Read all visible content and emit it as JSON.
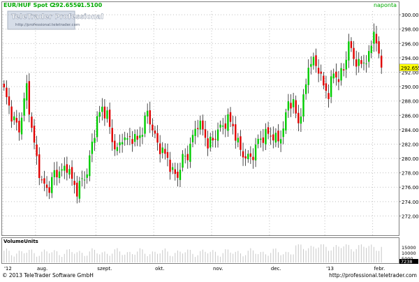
{
  "header": {
    "instrument_label": "EUR/HUF Spot C:",
    "last_price": "292.6550",
    "change": "-1.5100",
    "period_label": "naponta"
  },
  "logo": {
    "brand": "TeleTrader Professional",
    "url": "http://professional.teletrader.com"
  },
  "volume_panel": {
    "title": "VolumeUnits",
    "y_ticks": [
      "15000",
      "10000",
      "5000"
    ],
    "max_label": "7238"
  },
  "footer": {
    "copyright": "© 2013 TeleTrader Software GmbH",
    "url": "http://professional.teletrader.com"
  },
  "colors": {
    "up": "#00cc00",
    "down": "#e00000",
    "wick": "#000000",
    "last_price_bg": "#ffff00",
    "header_text": "#00aa00",
    "grid_dots": "#c0c0c0",
    "volume_bars": "#c8c8c8"
  },
  "chart_data": {
    "type": "candlestick",
    "title": "EUR/HUF Spot",
    "ylim": [
      270,
      300.5
    ],
    "y_ticks": [
      272,
      274,
      276,
      278,
      280,
      282,
      284,
      286,
      288,
      290,
      292,
      294,
      296,
      298,
      300
    ],
    "y_tick_labels": [
      "272.0000",
      "274.0000",
      "276.0000",
      "278.0000",
      "280.0000",
      "282.0000",
      "284.0000",
      "286.0000",
      "288.0000",
      "290.0000",
      "292.0000",
      "294.0000",
      "296.0000",
      "298.0000",
      "300.0000"
    ],
    "x_labels": [
      "'12",
      "aug.",
      "szept.",
      "okt.",
      "nov.",
      "dec.",
      "'13",
      "febr."
    ],
    "x_label_positions": [
      0,
      13,
      37,
      60,
      83,
      106,
      128,
      147
    ],
    "candle_count": 151,
    "price_anchors": [
      [
        0,
        289.5
      ],
      [
        3,
        286
      ],
      [
        6,
        284
      ],
      [
        9,
        290
      ],
      [
        11,
        284
      ],
      [
        13,
        280
      ],
      [
        15,
        276.5
      ],
      [
        18,
        275.8
      ],
      [
        20,
        278
      ],
      [
        23,
        278.2
      ],
      [
        25,
        279
      ],
      [
        27,
        277
      ],
      [
        29,
        275.5
      ],
      [
        31,
        277
      ],
      [
        33,
        278
      ],
      [
        35,
        282
      ],
      [
        37,
        285.5
      ],
      [
        39,
        287
      ],
      [
        41,
        286
      ],
      [
        43,
        282.5
      ],
      [
        45,
        281
      ],
      [
        47,
        283
      ],
      [
        49,
        282.5
      ],
      [
        51,
        283
      ],
      [
        53,
        282.5
      ],
      [
        55,
        284
      ],
      [
        57,
        286.5
      ],
      [
        59,
        284
      ],
      [
        61,
        282
      ],
      [
        63,
        281
      ],
      [
        65,
        280
      ],
      [
        67,
        278
      ],
      [
        69,
        277.6
      ],
      [
        71,
        280
      ],
      [
        73,
        280.5
      ],
      [
        75,
        283
      ],
      [
        77,
        285
      ],
      [
        79,
        284
      ],
      [
        81,
        282
      ],
      [
        83,
        282.5
      ],
      [
        85,
        284
      ],
      [
        87,
        284.5
      ],
      [
        89,
        285.5
      ],
      [
        91,
        284.5
      ],
      [
        93,
        282
      ],
      [
        95,
        280.5
      ],
      [
        97,
        280
      ],
      [
        99,
        280.5
      ],
      [
        101,
        282.5
      ],
      [
        103,
        283
      ],
      [
        105,
        283.5
      ],
      [
        107,
        283
      ],
      [
        109,
        282.5
      ],
      [
        111,
        284
      ],
      [
        113,
        288
      ],
      [
        115,
        287.5
      ],
      [
        117,
        285
      ],
      [
        119,
        288
      ],
      [
        121,
        293
      ],
      [
        123,
        293.5
      ],
      [
        125,
        292.5
      ],
      [
        127,
        290
      ],
      [
        129,
        289
      ],
      [
        131,
        292
      ],
      [
        133,
        291
      ],
      [
        135,
        292.5
      ],
      [
        137,
        296
      ],
      [
        139,
        294
      ],
      [
        141,
        293
      ],
      [
        143,
        293.5
      ],
      [
        145,
        294
      ],
      [
        147,
        298
      ],
      [
        149,
        294
      ],
      [
        150,
        292.65
      ]
    ],
    "volume_max": 7238
  }
}
